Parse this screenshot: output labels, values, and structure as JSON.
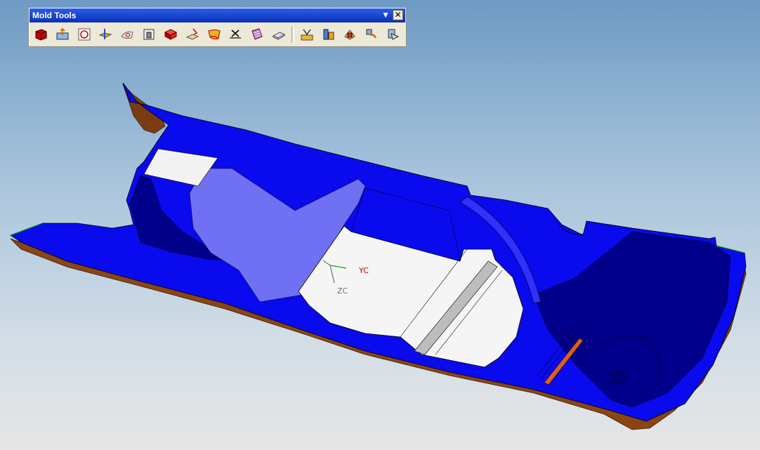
{
  "toolbar": {
    "title": "Mold Tools",
    "close_label": "✕",
    "tools": [
      {
        "name": "create-box-tool-icon"
      },
      {
        "name": "split-solid-tool-icon"
      },
      {
        "name": "trim-tool-icon"
      },
      {
        "name": "extend-tool-icon"
      },
      {
        "name": "surface-patch-tool-icon"
      },
      {
        "name": "replace-face-tool-icon"
      },
      {
        "name": "solid-patch-tool-icon"
      },
      {
        "name": "edge-patch-tool-icon"
      },
      {
        "name": "extend-face-tool-icon"
      },
      {
        "name": "delete-patch-tool-icon"
      },
      {
        "name": "existing-surface-tool-icon"
      },
      {
        "name": "bounding-body-tool-icon"
      },
      {
        "name": "parting-tool-icon"
      },
      {
        "name": "trim-mold-component-icon"
      },
      {
        "name": "reference-blend-icon"
      },
      {
        "name": "merge-cavity-icon"
      },
      {
        "name": "design-insert-icon"
      }
    ]
  },
  "view": {
    "axis_y_label": "YC",
    "axis_z_label": "ZC",
    "colors": {
      "part_face": "#0a0aee",
      "part_face_dark": "#00008a",
      "part_face_light": "#7070f5",
      "part_exterior": "#8b4513",
      "highlight": "#f5f5f5"
    }
  }
}
